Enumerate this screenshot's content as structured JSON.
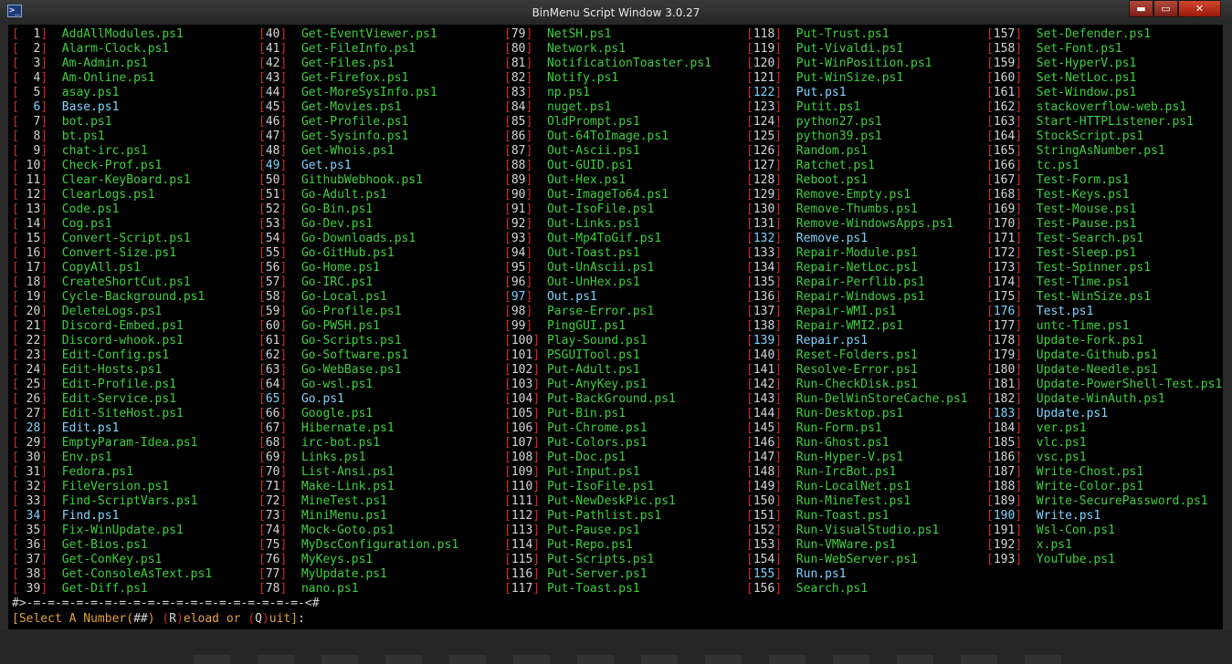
{
  "window": {
    "title": "BinMenu Script Window 3.0.27",
    "icon": "powershell-icon",
    "buttons": {
      "minimize": "▬",
      "maximize": "▭",
      "close": "✕"
    }
  },
  "colors": {
    "console_bg": "#000000",
    "bracket": "#d12a2a",
    "number": "#d6d6d6",
    "name": "#3fd03f",
    "highlight": "#7fd4ff",
    "prompt": "#e4a23a"
  },
  "scripts": [
    [
      "  1",
      "AddAllModules.ps1"
    ],
    [
      "  2",
      "Alarm-Clock.ps1"
    ],
    [
      "  3",
      "Am-Admin.ps1"
    ],
    [
      "  4",
      "Am-Online.ps1"
    ],
    [
      "  5",
      "asay.ps1"
    ],
    [
      "  6",
      "Base.ps1"
    ],
    [
      "  7",
      "bot.ps1"
    ],
    [
      "  8",
      "bt.ps1"
    ],
    [
      "  9",
      "chat-irc.ps1"
    ],
    [
      " 10",
      "Check-Prof.ps1"
    ],
    [
      " 11",
      "Clear-KeyBoard.ps1"
    ],
    [
      " 12",
      "ClearLogs.ps1"
    ],
    [
      " 13",
      "Code.ps1"
    ],
    [
      " 14",
      "Cog.ps1"
    ],
    [
      " 15",
      "Convert-Script.ps1"
    ],
    [
      " 16",
      "Convert-Size.ps1"
    ],
    [
      " 17",
      "CopyAll.ps1"
    ],
    [
      " 18",
      "CreateShortCut.ps1"
    ],
    [
      " 19",
      "Cycle-Background.ps1"
    ],
    [
      " 20",
      "DeleteLogs.ps1"
    ],
    [
      " 21",
      "Discord-Embed.ps1"
    ],
    [
      " 22",
      "Discord-whook.ps1"
    ],
    [
      " 23",
      "Edit-Config.ps1"
    ],
    [
      " 24",
      "Edit-Hosts.ps1"
    ],
    [
      " 25",
      "Edit-Profile.ps1"
    ],
    [
      " 26",
      "Edit-Service.ps1"
    ],
    [
      " 27",
      "Edit-SiteHost.ps1"
    ],
    [
      " 28",
      "Edit.ps1"
    ],
    [
      " 29",
      "EmptyParam-Idea.ps1"
    ],
    [
      " 30",
      "Env.ps1"
    ],
    [
      " 31",
      "Fedora.ps1"
    ],
    [
      " 32",
      "FileVersion.ps1"
    ],
    [
      " 33",
      "Find-ScriptVars.ps1"
    ],
    [
      " 34",
      "Find.ps1"
    ],
    [
      " 35",
      "Fix-WinUpdate.ps1"
    ],
    [
      " 36",
      "Get-Bios.ps1"
    ],
    [
      " 37",
      "Get-ConKey.ps1"
    ],
    [
      " 38",
      "Get-ConsoleAsText.ps1"
    ],
    [
      " 39",
      "Get-Diff.ps1"
    ],
    [
      "40",
      "Get-EventViewer.ps1"
    ],
    [
      "41",
      "Get-FileInfo.ps1"
    ],
    [
      "42",
      "Get-Files.ps1"
    ],
    [
      "43",
      "Get-Firefox.ps1"
    ],
    [
      "44",
      "Get-MoreSysInfo.ps1"
    ],
    [
      "45",
      "Get-Movies.ps1"
    ],
    [
      "46",
      "Get-Profile.ps1"
    ],
    [
      "47",
      "Get-Sysinfo.ps1"
    ],
    [
      "48",
      "Get-Whois.ps1"
    ],
    [
      "49",
      "Get.ps1"
    ],
    [
      "50",
      "GithubWebhook.ps1"
    ],
    [
      "51",
      "Go-Adult.ps1"
    ],
    [
      "52",
      "Go-Bin.ps1"
    ],
    [
      "53",
      "Go-Dev.ps1"
    ],
    [
      "54",
      "Go-Downloads.ps1"
    ],
    [
      "55",
      "Go-GitHub.ps1"
    ],
    [
      "56",
      "Go-Home.ps1"
    ],
    [
      "57",
      "Go-IRC.ps1"
    ],
    [
      "58",
      "Go-Local.ps1"
    ],
    [
      "59",
      "Go-Profile.ps1"
    ],
    [
      "60",
      "Go-PWSH.ps1"
    ],
    [
      "61",
      "Go-Scripts.ps1"
    ],
    [
      "62",
      "Go-Software.ps1"
    ],
    [
      "63",
      "Go-WebBase.ps1"
    ],
    [
      "64",
      "Go-wsl.ps1"
    ],
    [
      "65",
      "Go.ps1"
    ],
    [
      "66",
      "Google.ps1"
    ],
    [
      "67",
      "Hibernate.ps1"
    ],
    [
      "68",
      "irc-bot.ps1"
    ],
    [
      "69",
      "Links.ps1"
    ],
    [
      "70",
      "List-Ansi.ps1"
    ],
    [
      "71",
      "Make-Link.ps1"
    ],
    [
      "72",
      "MineTest.ps1"
    ],
    [
      "73",
      "MiniMenu.ps1"
    ],
    [
      "74",
      "Mock-Goto.ps1"
    ],
    [
      "75",
      "MyDscConfiguration.ps1"
    ],
    [
      "76",
      "MyKeys.ps1"
    ],
    [
      "77",
      "MyUpdate.ps1"
    ],
    [
      "78",
      "nano.ps1"
    ],
    [
      "79",
      "NetSH.ps1"
    ],
    [
      "80",
      "Network.ps1"
    ],
    [
      "81",
      "NotificationToaster.ps1"
    ],
    [
      "82",
      "Notify.ps1"
    ],
    [
      "83",
      "np.ps1"
    ],
    [
      "84",
      "nuget.ps1"
    ],
    [
      "85",
      "OldPrompt.ps1"
    ],
    [
      "86",
      "Out-64ToImage.ps1"
    ],
    [
      "87",
      "Out-Ascii.ps1"
    ],
    [
      "88",
      "Out-GUID.ps1"
    ],
    [
      "89",
      "Out-Hex.ps1"
    ],
    [
      "90",
      "Out-ImageTo64.ps1"
    ],
    [
      "91",
      "Out-IsoFile.ps1"
    ],
    [
      "92",
      "Out-Links.ps1"
    ],
    [
      "93",
      "Out-Mp4ToGif.ps1"
    ],
    [
      "94",
      "Out-Toast.ps1"
    ],
    [
      "95",
      "Out-UnAscii.ps1"
    ],
    [
      "96",
      "Out-UnHex.ps1"
    ],
    [
      "97",
      "Out.ps1"
    ],
    [
      "98",
      "Parse-Error.ps1"
    ],
    [
      "99",
      "PingGUI.ps1"
    ],
    [
      "100",
      "Play-Sound.ps1"
    ],
    [
      "101",
      "PSGUITool.ps1"
    ],
    [
      "102",
      "Put-Adult.ps1"
    ],
    [
      "103",
      "Put-AnyKey.ps1"
    ],
    [
      "104",
      "Put-BackGround.ps1"
    ],
    [
      "105",
      "Put-Bin.ps1"
    ],
    [
      "106",
      "Put-Chrome.ps1"
    ],
    [
      "107",
      "Put-Colors.ps1"
    ],
    [
      "108",
      "Put-Doc.ps1"
    ],
    [
      "109",
      "Put-Input.ps1"
    ],
    [
      "110",
      "Put-IsoFile.ps1"
    ],
    [
      "111",
      "Put-NewDeskPic.ps1"
    ],
    [
      "112",
      "Put-Pathlist.ps1"
    ],
    [
      "113",
      "Put-Pause.ps1"
    ],
    [
      "114",
      "Put-Repo.ps1"
    ],
    [
      "115",
      "Put-Scripts.ps1"
    ],
    [
      "116",
      "Put-Server.ps1"
    ],
    [
      "117",
      "Put-Toast.ps1"
    ],
    [
      "118",
      "Put-Trust.ps1"
    ],
    [
      "119",
      "Put-Vivaldi.ps1"
    ],
    [
      "120",
      "Put-WinPosition.ps1"
    ],
    [
      "121",
      "Put-WinSize.ps1"
    ],
    [
      "122",
      "Put.ps1"
    ],
    [
      "123",
      "Putit.ps1"
    ],
    [
      "124",
      "python27.ps1"
    ],
    [
      "125",
      "python39.ps1"
    ],
    [
      "126",
      "Random.ps1"
    ],
    [
      "127",
      "Ratchet.ps1"
    ],
    [
      "128",
      "Reboot.ps1"
    ],
    [
      "129",
      "Remove-Empty.ps1"
    ],
    [
      "130",
      "Remove-Thumbs.ps1"
    ],
    [
      "131",
      "Remove-WindowsApps.ps1"
    ],
    [
      "132",
      "Remove.ps1"
    ],
    [
      "133",
      "Repair-Module.ps1"
    ],
    [
      "134",
      "Repair-NetLoc.ps1"
    ],
    [
      "135",
      "Repair-Perflib.ps1"
    ],
    [
      "136",
      "Repair-Windows.ps1"
    ],
    [
      "137",
      "Repair-WMI.ps1"
    ],
    [
      "138",
      "Repair-WMI2.ps1"
    ],
    [
      "139",
      "Repair.ps1"
    ],
    [
      "140",
      "Reset-Folders.ps1"
    ],
    [
      "141",
      "Resolve-Error.ps1"
    ],
    [
      "142",
      "Run-CheckDisk.ps1"
    ],
    [
      "143",
      "Run-DelWinStoreCache.ps1"
    ],
    [
      "144",
      "Run-Desktop.ps1"
    ],
    [
      "145",
      "Run-Form.ps1"
    ],
    [
      "146",
      "Run-Ghost.ps1"
    ],
    [
      "147",
      "Run-Hyper-V.ps1"
    ],
    [
      "148",
      "Run-IrcBot.ps1"
    ],
    [
      "149",
      "Run-LocalNet.ps1"
    ],
    [
      "150",
      "Run-MineTest.ps1"
    ],
    [
      "151",
      "Run-Toast.ps1"
    ],
    [
      "152",
      "Run-VisualStudio.ps1"
    ],
    [
      "153",
      "Run-VMWare.ps1"
    ],
    [
      "154",
      "Run-WebServer.ps1"
    ],
    [
      "155",
      "Run.ps1"
    ],
    [
      "156",
      "Search.ps1"
    ],
    [
      "157",
      "Set-Defender.ps1"
    ],
    [
      "158",
      "Set-Font.ps1"
    ],
    [
      "159",
      "Set-HyperV.ps1"
    ],
    [
      "160",
      "Set-NetLoc.ps1"
    ],
    [
      "161",
      "Set-Window.ps1"
    ],
    [
      "162",
      "stackoverflow-web.ps1"
    ],
    [
      "163",
      "Start-HTTPListener.ps1"
    ],
    [
      "164",
      "StockScript.ps1"
    ],
    [
      "165",
      "StringAsNumber.ps1"
    ],
    [
      "166",
      "tc.ps1"
    ],
    [
      "167",
      "Test-Form.ps1"
    ],
    [
      "168",
      "Test-Keys.ps1"
    ],
    [
      "169",
      "Test-Mouse.ps1"
    ],
    [
      "170",
      "Test-Pause.ps1"
    ],
    [
      "171",
      "Test-Search.ps1"
    ],
    [
      "172",
      "Test-Sleep.ps1"
    ],
    [
      "173",
      "Test-Spinner.ps1"
    ],
    [
      "174",
      "Test-Time.ps1"
    ],
    [
      "175",
      "Test-WinSize.ps1"
    ],
    [
      "176",
      "Test.ps1"
    ],
    [
      "177",
      "untc-Time.ps1"
    ],
    [
      "178",
      "Update-Fork.ps1"
    ],
    [
      "179",
      "Update-Github.ps1"
    ],
    [
      "180",
      "Update-Needle.ps1"
    ],
    [
      "181",
      "Update-PowerShell-Test.ps1"
    ],
    [
      "182",
      "Update-WinAuth.ps1"
    ],
    [
      "183",
      "Update.ps1"
    ],
    [
      "184",
      "ver.ps1"
    ],
    [
      "185",
      "vlc.ps1"
    ],
    [
      "186",
      "vsc.ps1"
    ],
    [
      "187",
      "Write-Chost.ps1"
    ],
    [
      "188",
      "Write-Color.ps1"
    ],
    [
      "189",
      "Write-SecurePassword.ps1"
    ],
    [
      "190",
      "Write.ps1"
    ],
    [
      "191",
      "Wsl-Con.ps1"
    ],
    [
      "192",
      "x.ps1"
    ],
    [
      "193",
      "YouTube.ps1"
    ]
  ],
  "highlighted": [
    "6",
    "28",
    "34",
    "49",
    "65",
    "97",
    "122",
    "132",
    "139",
    "155",
    "176",
    "183",
    "190"
  ],
  "separator": "#>-=-=-=-=-=-=-=-=-=-=-=-=-=-=-=-=-=-=-=-<#",
  "prompt": {
    "open": "[",
    "text1": "Select A Number(",
    "hashes": "##",
    "text2": ") ",
    "r_open": "(",
    "r_key": "R",
    "r_close": ")",
    "reload": "eload or ",
    "q_open": "(",
    "q_key": "Q",
    "q_close": ")",
    "quit": "uit",
    "close": "]",
    "colon": ":"
  }
}
